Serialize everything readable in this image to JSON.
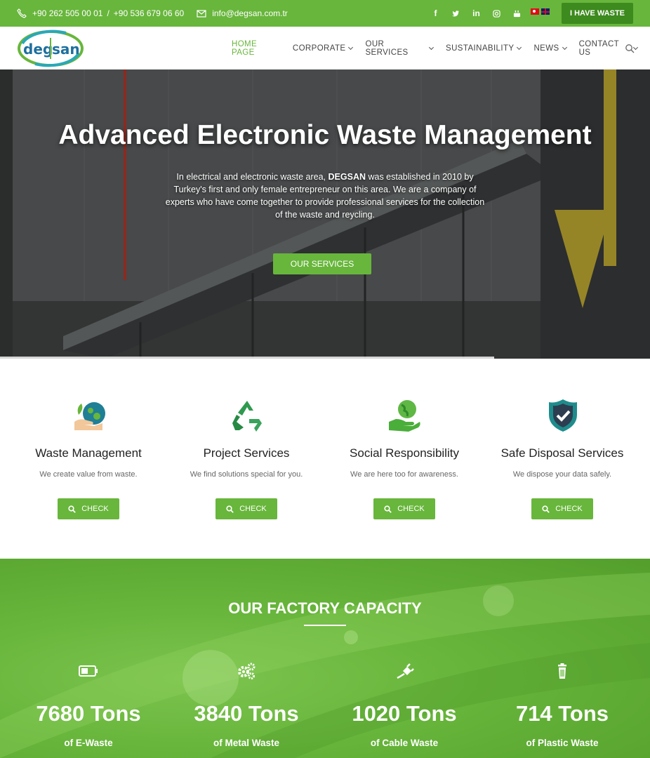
{
  "topbar": {
    "phone1": "+90 262 505 00 01",
    "phone_sep": "/",
    "phone2": "+90 536 679 06 60",
    "email": "info@degsan.com.tr",
    "social_icons": [
      "facebook-icon",
      "twitter-icon",
      "linkedin-icon",
      "instagram-icon",
      "youtube-icon"
    ],
    "languages": [
      "tr",
      "en"
    ],
    "cta_label": "I HAVE WASTE"
  },
  "logo": {
    "text_left": "deg",
    "text_right": "san"
  },
  "nav": {
    "items": [
      {
        "label": "HOME PAGE",
        "active": true
      },
      {
        "label": "CORPORATE",
        "dropdown": true
      },
      {
        "label": "OUR SERVICES",
        "dropdown": true
      },
      {
        "label": "SUSTAINABILITY",
        "dropdown": true
      },
      {
        "label": "NEWS",
        "dropdown": true
      },
      {
        "label": "CONTACT US",
        "dropdown": true
      }
    ]
  },
  "hero": {
    "title": "Advanced Electronic Waste Management",
    "desc_before": "In electrical and electronic waste area, ",
    "desc_bold": "DEGSAN",
    "desc_after": " was established in 2010 by Turkey's first and only female entrepreneur on this area. We are a company of experts who have come together to provide professional services for the collection of the waste and reycling.",
    "cta_label": "OUR SERVICES",
    "slide_progress": 0.76
  },
  "services": [
    {
      "title": "Waste Management",
      "text": "We create value from waste.",
      "button": "CHECK",
      "icon": "eco-hand-icon"
    },
    {
      "title": "Project Services",
      "text": "We find solutions special for you.",
      "button": "CHECK",
      "icon": "recycle-icon"
    },
    {
      "title": "Social Responsibility",
      "text": "We are here too for awareness.",
      "button": "CHECK",
      "icon": "globe-hand-icon"
    },
    {
      "title": "Safe Disposal Services",
      "text": "We dispose your data safely.",
      "button": "CHECK",
      "icon": "shield-check-icon"
    }
  ],
  "capacity": {
    "title": "OUR FACTORY CAPACITY",
    "stats": [
      {
        "number": "7680 Tons",
        "label": "of E-Waste",
        "icon": "battery-icon"
      },
      {
        "number": "3840 Tons",
        "label": "of Metal Waste",
        "icon": "gears-icon"
      },
      {
        "number": "1020 Tons",
        "label": "of Cable Waste",
        "icon": "plug-icon"
      },
      {
        "number": "714 Tons",
        "label": "of Plastic Waste",
        "icon": "trash-icon"
      }
    ]
  },
  "colors": {
    "brand_green": "#68b63c",
    "dark_green": "#3d8a1e",
    "teal": "#1f8c8c"
  }
}
